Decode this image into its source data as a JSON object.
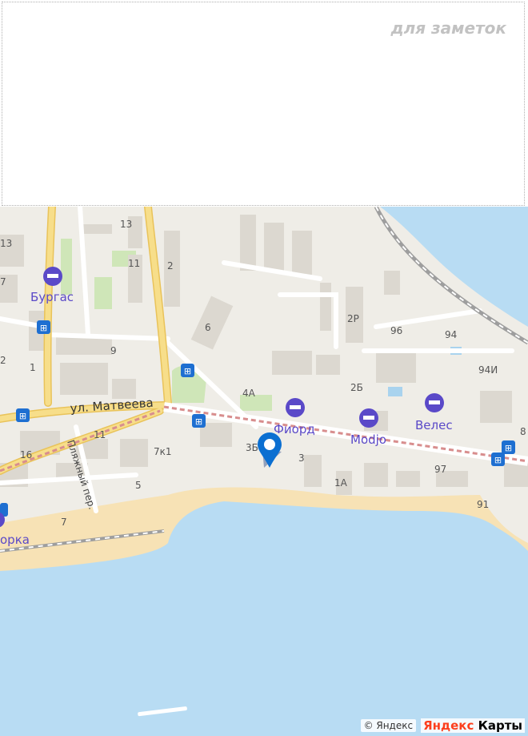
{
  "notes": {
    "label": "для заметок"
  },
  "map": {
    "colors": {
      "water": "#b8dcf3",
      "sand": "#f7e2b5",
      "land": "#efede7",
      "major_road": "#f2d36f",
      "railway": "#bdbdbd",
      "poi": "#5a49c8",
      "marker": "#0b6fd1"
    },
    "streets": [
      {
        "name": "ул. Матвеева"
      },
      {
        "name": "Пляжный пер."
      }
    ],
    "pois": [
      {
        "name": "Бургас",
        "icon": "hotel-icon"
      },
      {
        "name": "Фиорд",
        "icon": "hotel-icon"
      },
      {
        "name": "Modjo",
        "icon": "hotel-icon"
      },
      {
        "name": "Велес",
        "icon": "hotel-icon"
      },
      {
        "name": "орка",
        "icon": "hotel-icon"
      }
    ],
    "house_numbers": [
      "13",
      "13",
      "11",
      "2",
      "7",
      "6",
      "9",
      "1",
      "4А",
      "2",
      "11",
      "16",
      "7к1",
      "5",
      "7",
      "3Б",
      "3",
      "1А",
      "2Р",
      "96",
      "94",
      "94И",
      "2Б",
      "97",
      "91",
      "8"
    ],
    "marker": {
      "icon": "location-pin-icon"
    },
    "attribution": {
      "copyright": "© Яндекс",
      "brand_first": "Яндекс",
      "brand_second": "Карты"
    }
  }
}
